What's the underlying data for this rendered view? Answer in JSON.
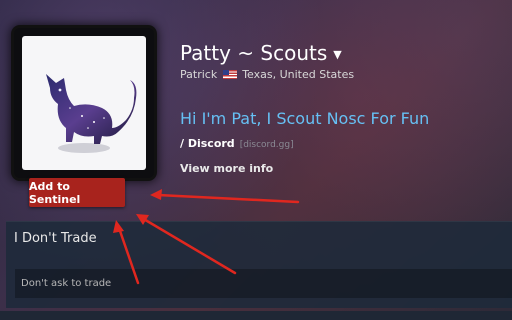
{
  "profile": {
    "persona_name": "Patty ~ Scouts",
    "real_name": "Patrick",
    "location": "Texas, United States",
    "summary": "Hi I'm Pat, I Scout Nosc For Fun",
    "discord_label": "/ Discord",
    "discord_link": "[discord.gg]",
    "view_more": "View more info",
    "add_button": "Add to Sentinel"
  },
  "showcase": {
    "title": "I Don't Trade",
    "body": "Don't ask to trade"
  },
  "colors": {
    "summary_blue": "#66c0f4",
    "button_red": "#a8231d",
    "arrow_red": "#e0271f"
  },
  "icons": {
    "flag": "us-flag-icon",
    "caret": "caret-down-icon"
  }
}
